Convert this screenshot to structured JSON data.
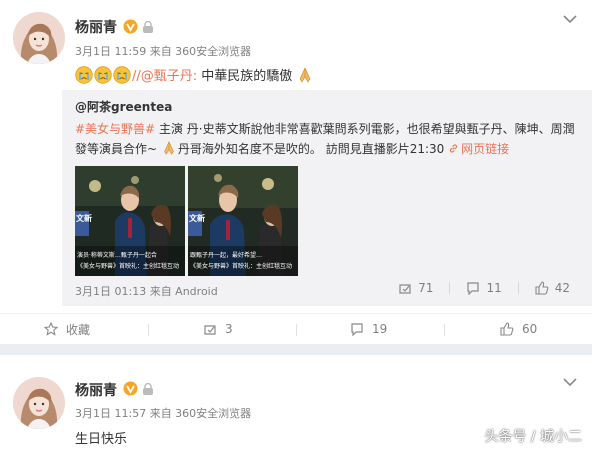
{
  "posts": [
    {
      "username": "杨丽青",
      "meta": "3月1日 11:59 来自 360安全浏览器",
      "mention": "//@甄子丹:",
      "text_after_mention": " 中華民族的驕傲",
      "repost": {
        "user": "@阿茶greentea",
        "hashtag": "#美女与野兽#",
        "line1_rest": " 主演 丹·史蒂文斯說他非常喜歡葉問系列電影，也很希望與甄子丹、陳坤、周潤",
        "line2_start": "發等演員合作~ ",
        "line2_mid": "丹哥海外知名度不是吹的。 訪問見直播影片21:30 ",
        "weblink": "网页链接",
        "meta": "3月1日 01:13 来自 Android",
        "thumb1_caption1": "演员·称蒂文斯…甄子丹一起合",
        "thumb1_caption2": "《美女与野兽》首映礼：主创红毯互动",
        "thumb1_side": "文新",
        "thumb2_caption1": "跟甄子丹一起，最好希望…",
        "thumb2_caption2": "《美女与野兽》首映礼：主创红毯互动",
        "thumb2_side": "文新",
        "stats": {
          "reposts": "71",
          "comments": "11",
          "likes": "42"
        }
      },
      "actions": {
        "favorite": "收藏",
        "reposts": "3",
        "comments": "19",
        "likes": "60"
      }
    },
    {
      "username": "杨丽青",
      "meta": "3月1日 11:57 来自 360安全浏览器",
      "text": "生日快乐"
    }
  ],
  "watermark": "头条号 / 城小二",
  "colors": {
    "link": "#eb7350",
    "meta": "#808080",
    "repost_bg": "#f2f2f5",
    "badge": "#f6a623"
  }
}
